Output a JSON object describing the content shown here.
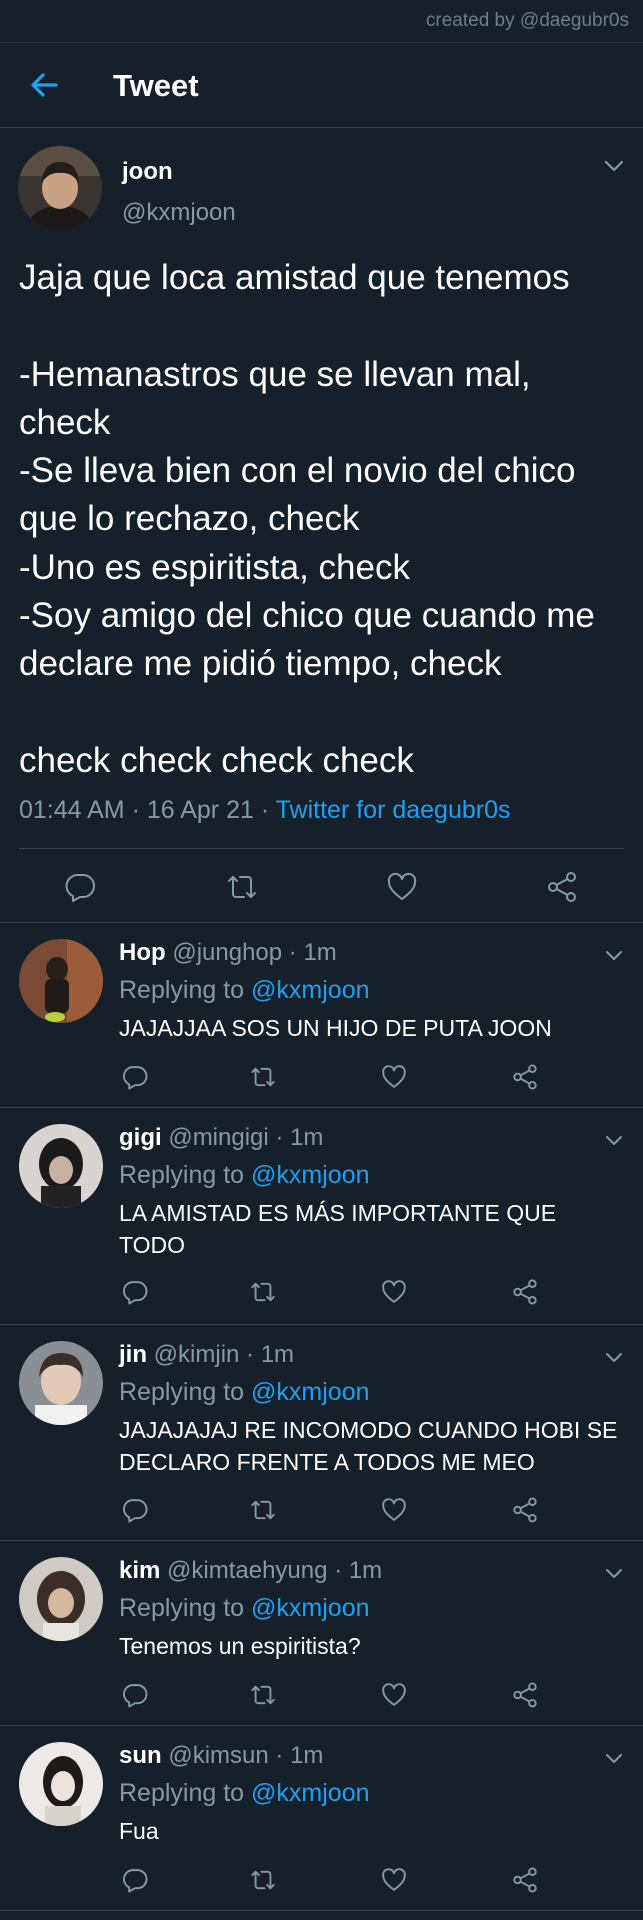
{
  "watermark": "created by @daegubr0s",
  "header": {
    "title": "Tweet",
    "accent": "#1da1f2"
  },
  "main_tweet": {
    "name": "joon",
    "handle": "@kxmjoon",
    "text": "Jaja que loca amistad que tenemos\n\n-Hemanastros que se llevan mal, check\n-Se lleva bien con el novio del chico que lo rechazo, check\n-Uno es espiritista, check\n-Soy amigo del chico que cuando me declare me pidió tiempo, check\n\ncheck check check check",
    "time": "01:44 AM",
    "date": "16 Apr 21",
    "source": "Twitter for daegubr0s",
    "actions": [
      "comment-icon",
      "retweet-icon",
      "heart-icon",
      "share-icon"
    ]
  },
  "replying_prefix": "Replying to",
  "replies": [
    {
      "name": "Hop",
      "handle": "@junghop",
      "time": "1m",
      "mention": "@kxmjoon",
      "text": "JAJAJJAA SOS UN HIJO DE PUTA JOON"
    },
    {
      "name": "gigi",
      "handle": "@mingigi",
      "time": "1m",
      "mention": "@kxmjoon",
      "text": "LA AMISTAD ES MÁS IMPORTANTE QUE TODO"
    },
    {
      "name": "jin",
      "handle": "@kimjin",
      "time": "1m",
      "mention": "@kxmjoon",
      "text": "JAJAJAJAJ RE INCOMODO CUANDO HOBI SE DECLARO FRENTE A TODOS ME MEO"
    },
    {
      "name": "kim",
      "handle": "@kimtaehyung",
      "time": "1m",
      "mention": "@kxmjoon",
      "text": "Tenemos un espiritista?"
    },
    {
      "name": "sun",
      "handle": "@kimsun",
      "time": "1m",
      "mention": "@kxmjoon",
      "text": "Fua"
    }
  ]
}
